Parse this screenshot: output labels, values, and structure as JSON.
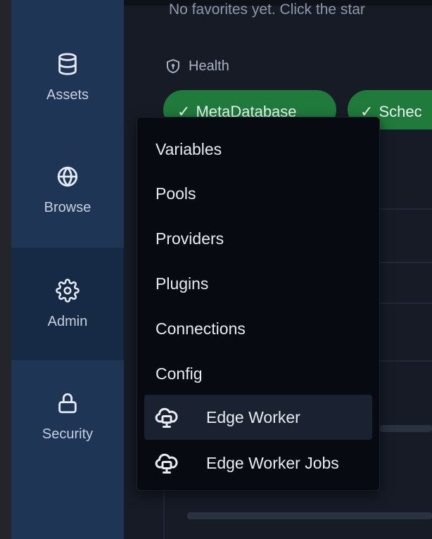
{
  "sidebar": {
    "items": [
      {
        "label": "Assets",
        "icon": "database-icon"
      },
      {
        "label": "Browse",
        "icon": "globe-icon"
      },
      {
        "label": "Admin",
        "icon": "gear-icon",
        "active": true
      },
      {
        "label": "Security",
        "icon": "lock-icon"
      }
    ]
  },
  "main": {
    "favorites_text": "No favorites yet. Click the star",
    "health": {
      "heading": "Health",
      "chips": [
        {
          "label": "MetaDatabase"
        },
        {
          "label": "Schec"
        }
      ]
    }
  },
  "admin_menu": {
    "items": [
      {
        "label": "Variables"
      },
      {
        "label": "Pools"
      },
      {
        "label": "Providers"
      },
      {
        "label": "Plugins"
      },
      {
        "label": "Connections"
      },
      {
        "label": "Config"
      },
      {
        "label": "Edge Worker",
        "icon": "edge-worker-icon",
        "highlighted": true
      },
      {
        "label": "Edge Worker Jobs",
        "icon": "edge-worker-jobs-icon"
      }
    ]
  },
  "colors": {
    "sidebar_bg": "#1e3556",
    "sidebar_active_bg": "#172a45",
    "menu_bg": "#070a10",
    "menu_highlight_bg": "#1a2131",
    "chip_green": "#1f7a3c"
  }
}
